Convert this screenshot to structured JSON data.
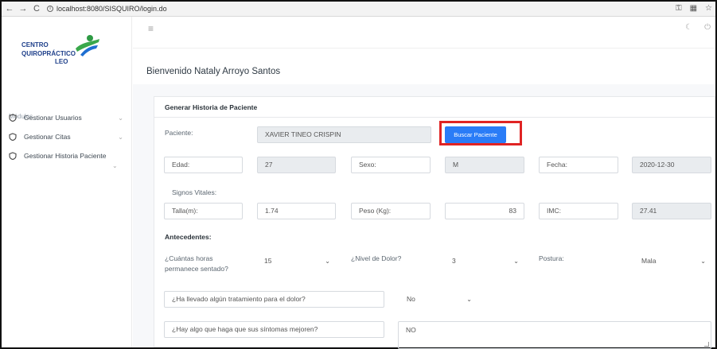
{
  "browser": {
    "back": "←",
    "forward": "→",
    "reload": "C",
    "url": "localhost:8080/SISQUIRO/login.do"
  },
  "sidebar": {
    "logo": {
      "line1": "CENTRO",
      "line2": "QUIROPRÁCTICO",
      "line3": "LEO"
    },
    "section": "Módulos",
    "items": [
      {
        "label": "Gestionar Usuarios"
      },
      {
        "label": "Gestionar Citas"
      },
      {
        "label": "Gestionar Historia Paciente"
      }
    ]
  },
  "header": {
    "welcome": "Bienvenido Nataly Arroyo Santos"
  },
  "form": {
    "title": "Generar Historia de Paciente",
    "patient_label": "Paciente:",
    "patient_value": "XAVIER  TINEO CRISPIN",
    "search_button": "Buscar Paciente",
    "age_label": "Edad:",
    "age_value": "27",
    "sex_label": "Sexo:",
    "sex_value": "M",
    "date_label": "Fecha:",
    "date_value": "2020-12-30",
    "vitals_label": "Signos Vitales:",
    "height_label": "Talla(m):",
    "height_value": "1.74",
    "weight_label": "Peso (Kg):",
    "weight_value": "83",
    "bmi_label": "IMC:",
    "bmi_value": "27.41",
    "antecedentes_label": "Antecedentes:",
    "hours_question_l1": "¿Cuántas horas",
    "hours_question_l2": "permanece sentado?",
    "hours_value": "15",
    "pain_label": "¿Nivel de Dolor?",
    "pain_value": "3",
    "posture_label": "Postura:",
    "posture_value": "Mala",
    "treatment_question": "¿Ha llevado algún tratamiento para el dolor?",
    "treatment_value": "No",
    "improve_question": "¿Hay algo que haga que sus síntomas mejoren?",
    "improve_value": "NO"
  }
}
